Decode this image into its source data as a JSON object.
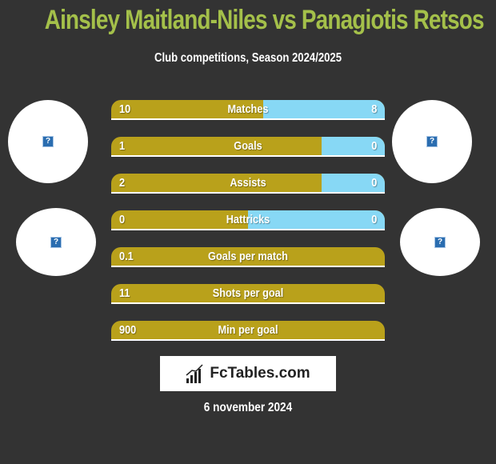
{
  "header": {
    "title": "Ainsley Maitland-Niles vs Panagiotis Retsos",
    "subtitle": "Club competitions, Season 2024/2025"
  },
  "players": {
    "left": {
      "name": "Ainsley Maitland-Niles",
      "avatar_icon": "image-placeholder-icon",
      "club_icon": "image-placeholder-icon"
    },
    "right": {
      "name": "Panagiotis Retsos",
      "avatar_icon": "image-placeholder-icon",
      "club_icon": "image-placeholder-icon"
    }
  },
  "colors": {
    "title": "#a4c04a",
    "left_bar": "#b9a11b",
    "right_bar": "#87d8f5",
    "background": "#333333"
  },
  "stats": [
    {
      "label": "Matches",
      "left": "10",
      "right": "8",
      "right_share": 0.444
    },
    {
      "label": "Goals",
      "left": "1",
      "right": "0",
      "right_share": 0.23
    },
    {
      "label": "Assists",
      "left": "2",
      "right": "0",
      "right_share": 0.23
    },
    {
      "label": "Hattricks",
      "left": "0",
      "right": "0",
      "right_share": 0.5
    },
    {
      "label": "Goals per match",
      "left": "0.1",
      "right": "",
      "right_share": 0
    },
    {
      "label": "Shots per goal",
      "left": "11",
      "right": "",
      "right_share": 0
    },
    {
      "label": "Min per goal",
      "left": "900",
      "right": "",
      "right_share": 0
    }
  ],
  "footer": {
    "logo_text": "FcTables.com",
    "logo_icon": "bar-chart-icon",
    "date": "6 november 2024"
  }
}
